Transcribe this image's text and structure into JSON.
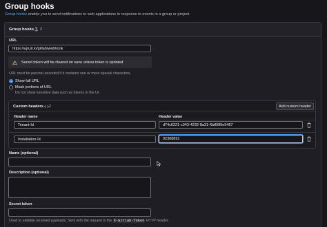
{
  "page": {
    "title": "Group hooks",
    "desc_link": "Group hooks",
    "desc_rest": " enable you to send notifications to web applications in response to events in a group or project."
  },
  "card": {
    "title": "Group hooks",
    "count": "2"
  },
  "url": {
    "label": "URL",
    "value": "https://api.jit.io/gitlab/webhook",
    "alert": "Secret token will be cleared on save unless token is updated.",
    "help": "URL must be percent-encoded if it contains one or more special characters."
  },
  "url_mode": {
    "show_label": "Show full URL",
    "mask_label": "Mask portions of URL",
    "mask_help": "Do not show sensitive data such as tokens in the UI.",
    "selected": "show"
  },
  "custom_headers": {
    "title": "Custom headers",
    "count": "2",
    "add_button": "Add custom header",
    "col_name": "Header name",
    "col_value": "Header value",
    "rows": [
      {
        "name": "Tenant-Id",
        "value": "d74c6221-c343-4232-8a31-f9d66f9e9487"
      },
      {
        "name": "Installation-Id",
        "value": "92368891"
      }
    ]
  },
  "name_field": {
    "label": "Name (optional)",
    "value": ""
  },
  "description_field": {
    "label": "Description (optional)",
    "value": ""
  },
  "secret": {
    "label": "Secret token",
    "help_pre": "Used to validate received payloads. Sent with the request in the ",
    "help_code": "X-Gitlab-Token",
    "help_post": " HTTP header."
  },
  "colors": {
    "background": "#17161a",
    "accent": "#428fdc",
    "link": "#63a6e9",
    "warning": "#e9be74",
    "focus_border": "#b5cdf0"
  }
}
